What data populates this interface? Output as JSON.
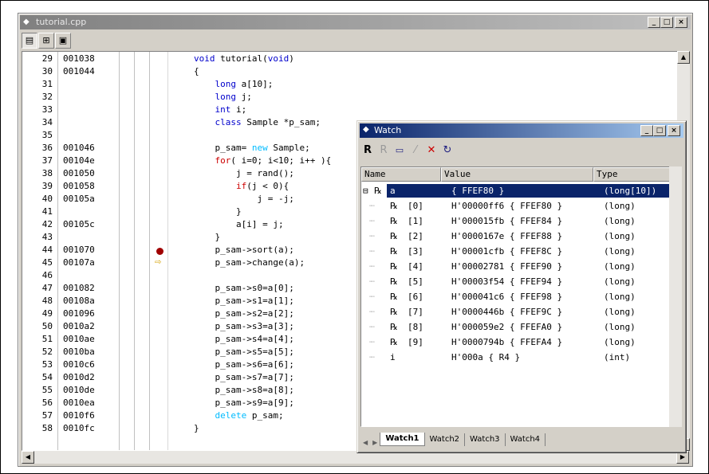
{
  "window": {
    "title": "tutorial.cpp",
    "min": "_",
    "max": "□",
    "close": "×"
  },
  "toolbar": {
    "b1": "▤",
    "b2": "⊞",
    "b3": "▣"
  },
  "lines": [
    {
      "n": "29",
      "addr": "001038",
      "code": "void tutorial(void)"
    },
    {
      "n": "30",
      "addr": "001044",
      "code": "{"
    },
    {
      "n": "31",
      "addr": "",
      "code": "    long a[10];"
    },
    {
      "n": "32",
      "addr": "",
      "code": "    long j;"
    },
    {
      "n": "33",
      "addr": "",
      "code": "    int i;"
    },
    {
      "n": "34",
      "addr": "",
      "code": "    class Sample *p_sam;"
    },
    {
      "n": "35",
      "addr": "",
      "code": ""
    },
    {
      "n": "36",
      "addr": "001046",
      "code": "    p_sam= new Sample;"
    },
    {
      "n": "37",
      "addr": "00104e",
      "code": "    for( i=0; i<10; i++ ){"
    },
    {
      "n": "38",
      "addr": "001050",
      "code": "        j = rand();"
    },
    {
      "n": "39",
      "addr": "001058",
      "code": "        if(j < 0){"
    },
    {
      "n": "40",
      "addr": "00105a",
      "code": "            j = -j;"
    },
    {
      "n": "41",
      "addr": "",
      "code": "        }"
    },
    {
      "n": "42",
      "addr": "00105c",
      "code": "        a[i] = j;"
    },
    {
      "n": "43",
      "addr": "",
      "code": "    }"
    },
    {
      "n": "44",
      "addr": "001070",
      "code": "    p_sam->sort(a);"
    },
    {
      "n": "45",
      "addr": "00107a",
      "code": "    p_sam->change(a);"
    },
    {
      "n": "46",
      "addr": "",
      "code": ""
    },
    {
      "n": "47",
      "addr": "001082",
      "code": "    p_sam->s0=a[0];"
    },
    {
      "n": "48",
      "addr": "00108a",
      "code": "    p_sam->s1=a[1];"
    },
    {
      "n": "49",
      "addr": "001096",
      "code": "    p_sam->s2=a[2];"
    },
    {
      "n": "50",
      "addr": "0010a2",
      "code": "    p_sam->s3=a[3];"
    },
    {
      "n": "51",
      "addr": "0010ae",
      "code": "    p_sam->s4=a[4];"
    },
    {
      "n": "52",
      "addr": "0010ba",
      "code": "    p_sam->s5=a[5];"
    },
    {
      "n": "53",
      "addr": "0010c6",
      "code": "    p_sam->s6=a[6];"
    },
    {
      "n": "54",
      "addr": "0010d2",
      "code": "    p_sam->s7=a[7];"
    },
    {
      "n": "55",
      "addr": "0010de",
      "code": "    p_sam->s8=a[8];"
    },
    {
      "n": "56",
      "addr": "0010ea",
      "code": "    p_sam->s9=a[9];"
    },
    {
      "n": "57",
      "addr": "0010f6",
      "code": "    delete p_sam;"
    },
    {
      "n": "58",
      "addr": "0010fc",
      "code": "}"
    }
  ],
  "watch": {
    "title": "Watch",
    "headers": {
      "name": "Name",
      "value": "Value",
      "type": "Type"
    },
    "rows": [
      {
        "name": "a",
        "value": "{ FFEF80 }",
        "type": "(long[10])"
      },
      {
        "name": "[0]",
        "value": "H'00000ff6 { FFEF80 }",
        "type": "(long)"
      },
      {
        "name": "[1]",
        "value": "H'000015fb { FFEF84 }",
        "type": "(long)"
      },
      {
        "name": "[2]",
        "value": "H'0000167e { FFEF88 }",
        "type": "(long)"
      },
      {
        "name": "[3]",
        "value": "H'00001cfb { FFEF8C }",
        "type": "(long)"
      },
      {
        "name": "[4]",
        "value": "H'00002781 { FFEF90 }",
        "type": "(long)"
      },
      {
        "name": "[5]",
        "value": "H'00003f54 { FFEF94 }",
        "type": "(long)"
      },
      {
        "name": "[6]",
        "value": "H'000041c6 { FFEF98 }",
        "type": "(long)"
      },
      {
        "name": "[7]",
        "value": "H'0000446b { FFEF9C }",
        "type": "(long)"
      },
      {
        "name": "[8]",
        "value": "H'000059e2 { FFEFA0 }",
        "type": "(long)"
      },
      {
        "name": "[9]",
        "value": "H'0000794b { FFEFA4 }",
        "type": "(long)"
      },
      {
        "name": "i",
        "value": "H'000a { R4 }",
        "type": "(int)"
      }
    ],
    "tabs": [
      "Watch1",
      "Watch2",
      "Watch3",
      "Watch4"
    ]
  },
  "colors": {
    "title_active": "#0a246a",
    "breakpoint": "#a00000",
    "keyword": "#0000cc"
  }
}
